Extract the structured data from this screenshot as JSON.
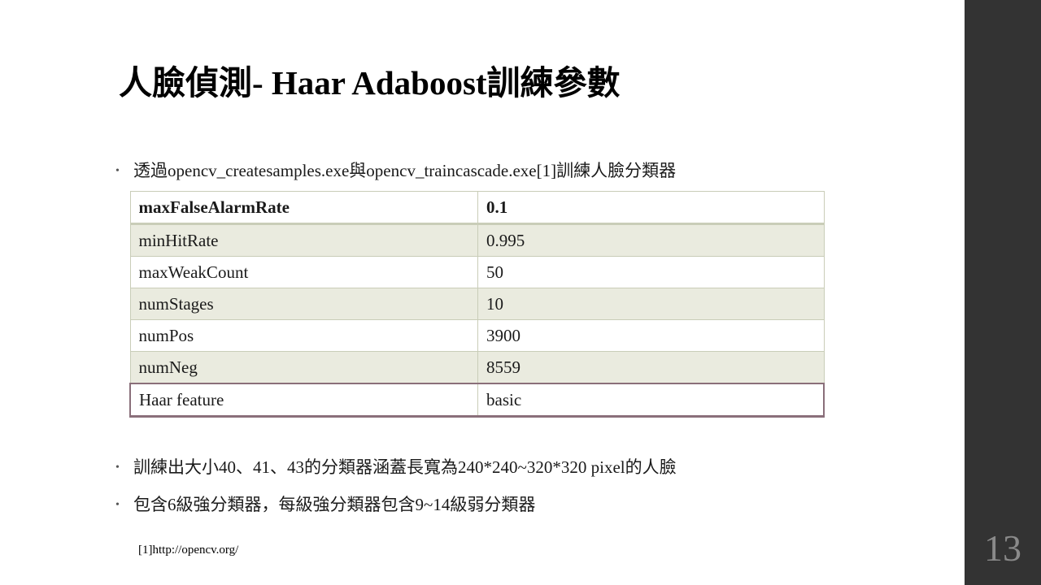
{
  "slide": {
    "title": "人臉偵測- Haar Adaboost訓練參數",
    "bullets": [
      "透過opencv_createsamples.exe與opencv_traincascade.exe[1]訓練人臉分類器",
      "訓練出大小40、41、43的分類器涵蓋長寬為240*240~320*320  pixel的人臉",
      "包含6級強分類器，每級強分類器包含9~14級弱分類器"
    ],
    "bullet_glyph": "•",
    "table": {
      "rows": [
        [
          "maxFalseAlarmRate",
          "0.1"
        ],
        [
          "minHitRate",
          "0.995"
        ],
        [
          "maxWeakCount",
          "50"
        ],
        [
          "numStages",
          "10"
        ],
        [
          "numPos",
          "3900"
        ],
        [
          "numNeg",
          "8559"
        ],
        [
          "Haar feature",
          "basic"
        ]
      ]
    },
    "footnote": "[1]http://opencv.org/",
    "page_number": "13"
  },
  "colors": {
    "sidebar": "#333333",
    "table_shade": "#eaebdf",
    "table_border": "#c9cdb8",
    "last_row_border": "#8a6f7a"
  }
}
